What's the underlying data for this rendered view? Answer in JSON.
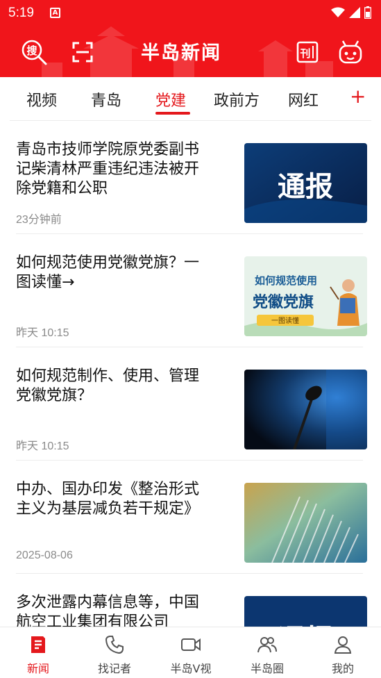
{
  "status_bar": {
    "time": "5:19",
    "app_badge": "A"
  },
  "header": {
    "logo": "半岛新闻",
    "left_icons": [
      "search-icon",
      "scan-icon"
    ],
    "right_icons": [
      "newspaper-icon",
      "robot-icon"
    ],
    "search_icon_text": "搜",
    "newspaper_icon_text": "刊"
  },
  "tabs": {
    "items": [
      {
        "label": "视频"
      },
      {
        "label": "青岛"
      },
      {
        "label": "党建"
      },
      {
        "label": "政前方"
      },
      {
        "label": "网红"
      }
    ],
    "active": "党建",
    "add_label": "+"
  },
  "news": [
    {
      "title": "青岛市技师学院原党委副书记柴清林严重违纪违法被开除党籍和公职",
      "time": "23分钟前",
      "thumb": {
        "type": "notice",
        "text": "通报"
      }
    },
    {
      "title": "如何规范使用党徽党旗？一图读懂→",
      "time": "昨天 10:15",
      "thumb": {
        "type": "infographic",
        "line1": "如何规范使用",
        "line2": "党徽党旗",
        "line3": "一图读懂"
      }
    },
    {
      "title": "如何规范制作、使用、管理党徽党旗？",
      "time": "昨天 10:15",
      "thumb": {
        "type": "microphone"
      }
    },
    {
      "title": "中办、国办印发《整治形式主义为基层减负若干规定》",
      "time": "2025-08-06",
      "thumb": {
        "type": "books"
      }
    },
    {
      "title": "多次泄露内幕信息等，中国航空工业集团有限公司",
      "time": "",
      "thumb": {
        "type": "notice",
        "text": "通报"
      }
    }
  ],
  "bottom_nav": {
    "items": [
      {
        "label": "新闻",
        "icon": "news-icon"
      },
      {
        "label": "找记者",
        "icon": "phone-icon"
      },
      {
        "label": "半岛V视",
        "icon": "video-camera-icon"
      },
      {
        "label": "半岛圈",
        "icon": "people-icon"
      },
      {
        "label": "我的",
        "icon": "person-icon"
      }
    ],
    "active": "新闻"
  },
  "colors": {
    "brand_red": "#f0151b",
    "active_red": "#e4181c",
    "text": "#111111",
    "meta": "#8a8a8a"
  }
}
